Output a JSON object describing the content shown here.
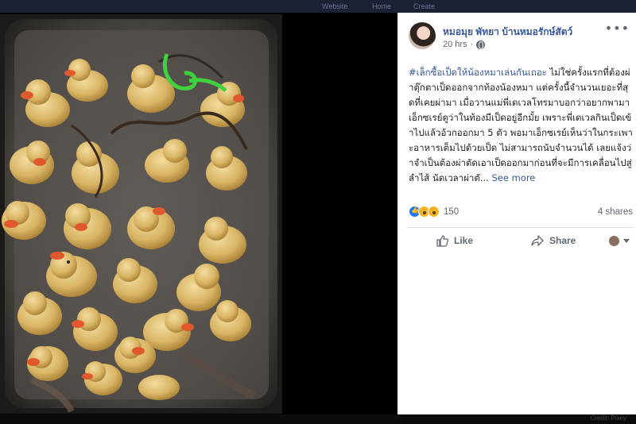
{
  "topbar": {
    "ghost_items": [
      "Website",
      "Home",
      "Create"
    ]
  },
  "post": {
    "author": "หมอมุย พัทยา บ้านหมอรักษ์สัตว์",
    "time": "20 hrs",
    "privacy_icon": "globe-icon",
    "more_icon": "more-dots-icon",
    "more_label": "•••",
    "hashtag": "#เล็กซื้อเป็ดให้น้องหมาเล่นกันเถอะ",
    "text": " ไม่ใช่ครั้งแรกที่ต้องผ่าตุ๊กตาเป็ดออกจากท้องน้องหมา แต่ครั้งนี้จำนวนเยอะที่สุดที่เคยผ่ามา เมื่อวานแม่พี่เดเวลโทรมาบอกว่าอยากพามาเอ็กซเรย์ดูว่าในท้องมีเป็ดอยู่อีกมั้ย เพราะพี่เดเวลกินเป็ดเข้าไปแล้วอ้วกออกมา 5 ตัว พอมาเอ็กซเรย์เห็นว่าในกระเพาะอาหารเต็มไปด้วยเป็ด ไม่สามารถนับจำนวนได้ เลยแจ้งว่าจำเป็นต้องผ่าตัดเอาเป็ดออกมาก่อนที่จะมีการเคลื่อนไปสู่ลำไส้ นัดเวลาผ่าตั... ",
    "see_more": "See more"
  },
  "reactions": {
    "icons": [
      "like-reaction-icon",
      "wow-reaction-icon",
      "sad-reaction-icon"
    ],
    "count": "150",
    "shares": "4 shares"
  },
  "actions": {
    "like_label": "Like",
    "share_label": "Share"
  },
  "footer": {
    "credit": "Credit: Pixey"
  },
  "colors": {
    "link": "#385898",
    "text": "#1c1e21",
    "muted": "#606770",
    "divider": "#dadde1",
    "like_blue": "#2078f4",
    "reaction_yellow": "#f7b125"
  }
}
